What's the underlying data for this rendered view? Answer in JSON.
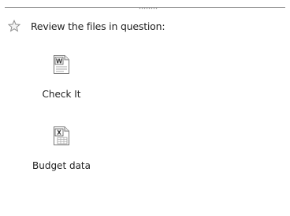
{
  "header": {
    "title": "Review the files in question:",
    "icon": "star-icon"
  },
  "attachments": [
    {
      "label": "Check It",
      "icon": "word-document-icon"
    },
    {
      "label": "Budget data",
      "icon": "excel-spreadsheet-icon"
    }
  ],
  "colors": {
    "word_blue": "#2a5db0",
    "excel_green": "#3c7a3c"
  }
}
